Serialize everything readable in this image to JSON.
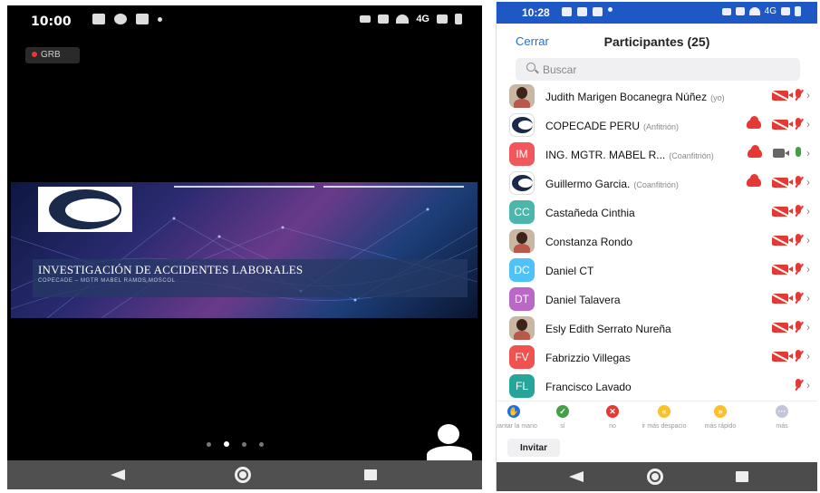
{
  "left": {
    "status": {
      "time": "10:00",
      "network": "4G"
    },
    "rec_label": "GRB",
    "slide": {
      "logo_text": "COPECADE",
      "title": "INVESTIGACIÓN DE ACCIDENTES LABORALES",
      "subtitle": "COPECADE – MGTR MABEL RAMOS MOSCOL"
    }
  },
  "right": {
    "status": {
      "time": "10:28",
      "network": "4G"
    },
    "close_label": "Cerrar",
    "title": "Participantes (25)",
    "search_placeholder": "Buscar",
    "participants": [
      {
        "initials": "",
        "avatar": "photo",
        "name": "Judith Marigen Bocanegra Núñez",
        "role": "(yo)",
        "cloud": false,
        "video": "off",
        "mic": "off",
        "color": ""
      },
      {
        "initials": "",
        "avatar": "logo",
        "name": "COPECADE PERU",
        "role": "(Anfitrión)",
        "cloud": true,
        "video": "off",
        "mic": "off",
        "color": ""
      },
      {
        "initials": "IM",
        "avatar": "initials",
        "name": "ING. MGTR. MABEL R...",
        "role": "(Coanfitrión)",
        "cloud": true,
        "video": "on",
        "mic": "on",
        "color": "#f0585c"
      },
      {
        "initials": "",
        "avatar": "logo",
        "name": "Guillermo Garcia.",
        "role": "(Coanfitrión)",
        "cloud": true,
        "video": "off",
        "mic": "off",
        "color": ""
      },
      {
        "initials": "CC",
        "avatar": "initials",
        "name": "Castañeda Cinthia",
        "role": "",
        "cloud": false,
        "video": "off",
        "mic": "off",
        "color": "#4db6ac"
      },
      {
        "initials": "",
        "avatar": "photo",
        "name": "Constanza Rondo",
        "role": "",
        "cloud": false,
        "video": "off",
        "mic": "off",
        "color": ""
      },
      {
        "initials": "DC",
        "avatar": "initials",
        "name": "Daniel CT",
        "role": "",
        "cloud": false,
        "video": "off",
        "mic": "off",
        "color": "#4fc3f7"
      },
      {
        "initials": "DT",
        "avatar": "initials",
        "name": "Daniel Talavera",
        "role": "",
        "cloud": false,
        "video": "off",
        "mic": "off",
        "color": "#ba68c8"
      },
      {
        "initials": "",
        "avatar": "photo",
        "name": "Esly Edith Serrato Nureña",
        "role": "",
        "cloud": false,
        "video": "off",
        "mic": "off",
        "color": ""
      },
      {
        "initials": "FV",
        "avatar": "initials",
        "name": "Fabrizzio Villegas",
        "role": "",
        "cloud": false,
        "video": "off",
        "mic": "off",
        "color": "#ef5350"
      },
      {
        "initials": "FL",
        "avatar": "initials",
        "name": "Francisco Lavado",
        "role": "",
        "cloud": false,
        "video": "none",
        "mic": "off",
        "color": "#26a69a"
      }
    ],
    "reactions": [
      {
        "label": "levantar la mano",
        "color": "#1e6fe0",
        "glyph": "✋"
      },
      {
        "label": "sí",
        "color": "#43a047",
        "glyph": "✓"
      },
      {
        "label": "no",
        "color": "#e53935",
        "glyph": "✕"
      },
      {
        "label": "ir más despacio",
        "color": "#fbc02d",
        "glyph": "«"
      },
      {
        "label": "más rápido",
        "color": "#fbc02d",
        "glyph": "»"
      },
      {
        "label": "más",
        "color": "#c5c5d8",
        "glyph": "···"
      }
    ],
    "invite_label": "Invitar"
  }
}
